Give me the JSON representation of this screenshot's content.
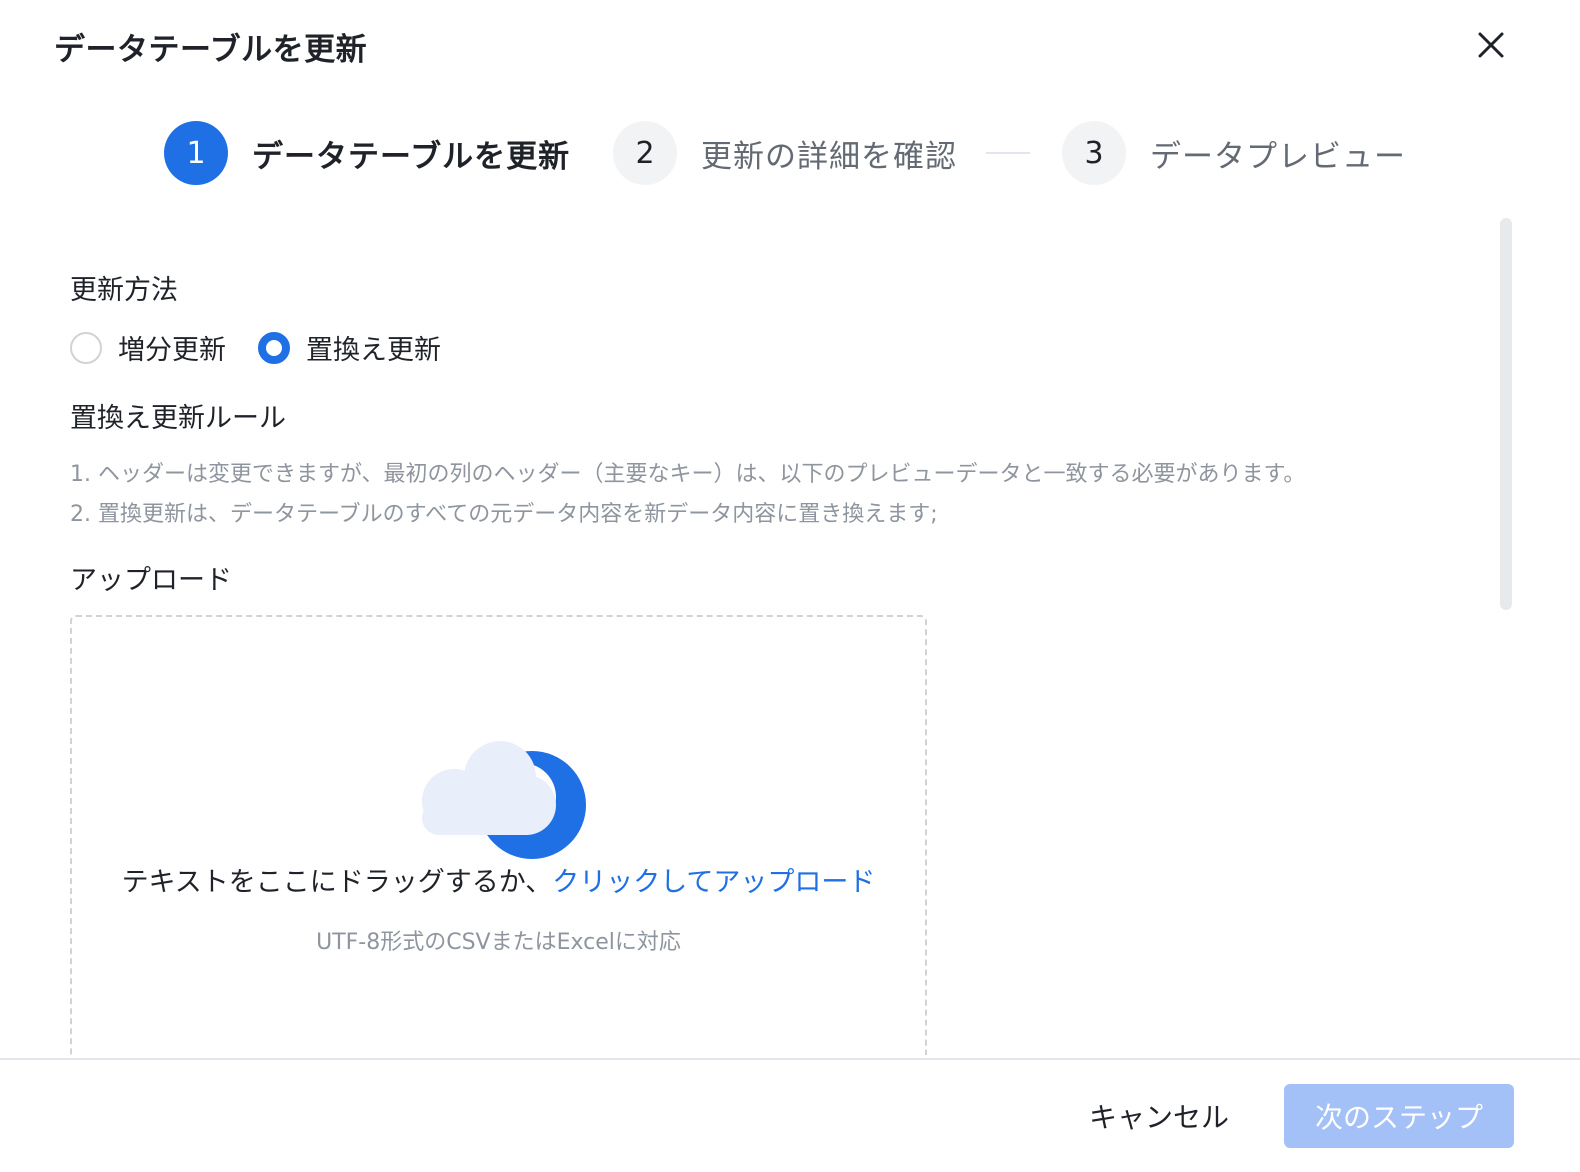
{
  "dialog": {
    "title": "データテーブルを更新",
    "close_icon": "close-icon"
  },
  "steps": [
    {
      "number": "1",
      "label": "データテーブルを更新",
      "state": "active"
    },
    {
      "number": "2",
      "label": "更新の詳細を確認",
      "state": "inactive"
    },
    {
      "number": "3",
      "label": "データプレビュー",
      "state": "inactive"
    }
  ],
  "update_method": {
    "label": "更新方法",
    "options": [
      {
        "label": "増分更新",
        "checked": false
      },
      {
        "label": "置換え更新",
        "checked": true
      }
    ]
  },
  "rules": {
    "label": "置換え更新ルール",
    "items": [
      "1. ヘッダーは変更できますが、最初の列のヘッダー（主要なキー）は、以下のプレビューデータと一致する必要があります。",
      "2. 置換更新は、データテーブルのすべての元データ内容を新データ内容に置き換えます;"
    ]
  },
  "upload": {
    "label": "アップロード",
    "icon": "cloud-upload-icon",
    "drag_text": "テキストをここにドラッグするか、",
    "link_text": "クリックしてアップロード",
    "support_text": "UTF-8形式のCSVまたはExcelに対応"
  },
  "footer": {
    "cancel_label": "キャンセル",
    "next_label": "次のステップ"
  },
  "colors": {
    "primary": "#1f6fe5",
    "primary_disabled": "#a3c1f6",
    "muted_text": "#8f959e"
  }
}
